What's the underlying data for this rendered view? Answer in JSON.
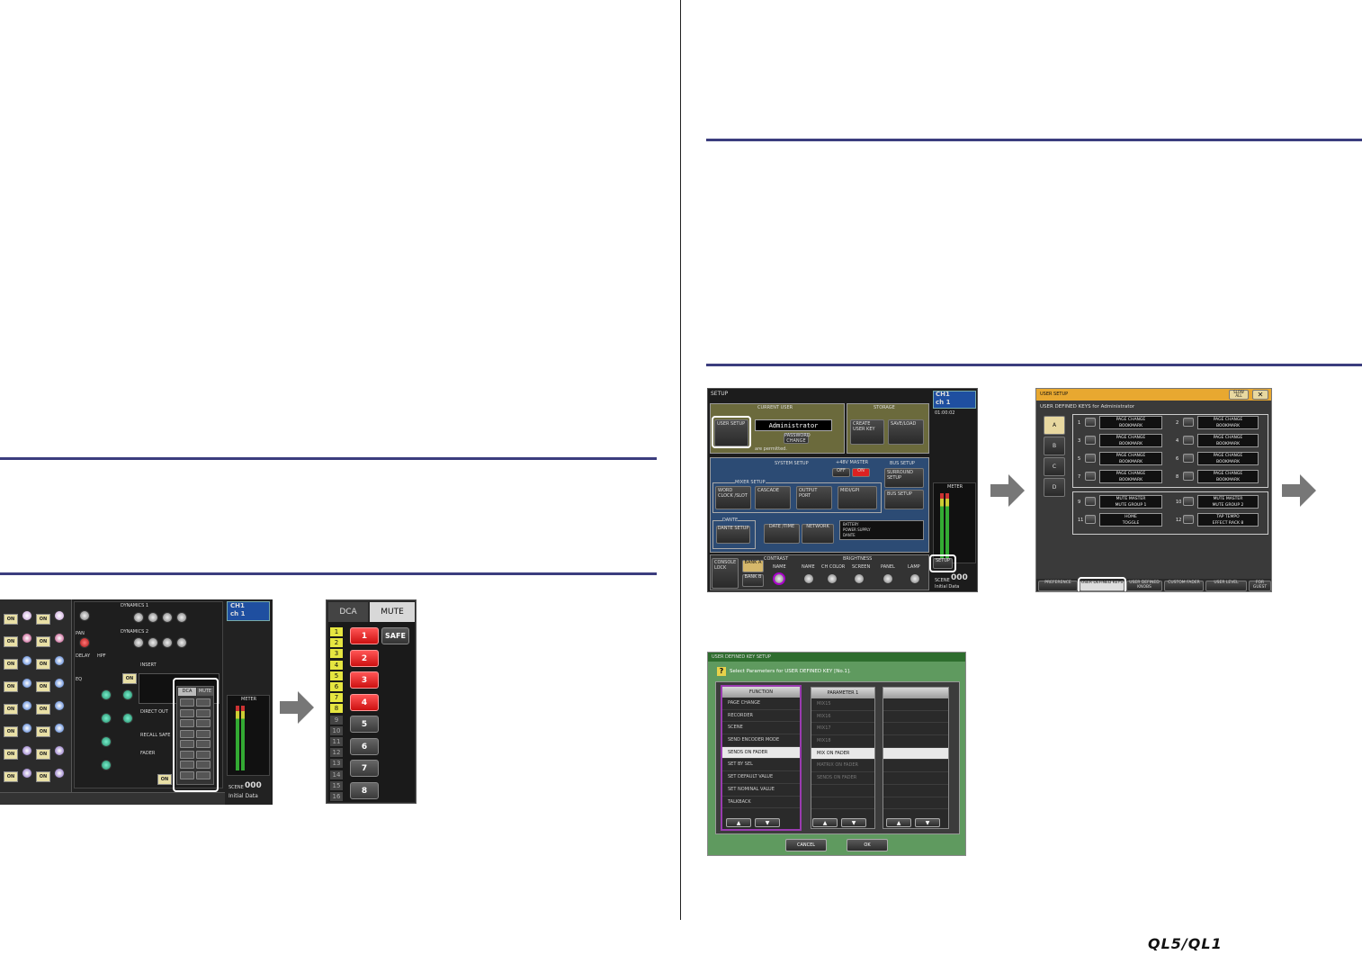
{
  "brand": "QL5/QL1",
  "mixer_shot": {
    "ch_label": "CH1",
    "ch_name": "ch 1",
    "tabs": [
      "DCA",
      "MUTE"
    ],
    "scene_label": "SCENE",
    "scene_number": "000",
    "scene_title": "Initial Data",
    "section_labels": [
      "EQ",
      "DYNAMICS 1",
      "DYNAMICS 2",
      "PAN",
      "DELAY",
      "HPF",
      "INSERT",
      "DIRECT OUT",
      "RECALL SAFE",
      "FADER",
      "METER"
    ]
  },
  "mute_panel": {
    "tabs": [
      "DCA",
      "MUTE"
    ],
    "safe_label": "SAFE",
    "group_numbers": [
      "1",
      "2",
      "3",
      "4",
      "5",
      "6",
      "7",
      "8",
      "9",
      "10",
      "11",
      "12",
      "13",
      "14",
      "15",
      "16"
    ],
    "buttons": [
      {
        "label": "1",
        "active": true
      },
      {
        "label": "2",
        "active": true
      },
      {
        "label": "3",
        "active": true
      },
      {
        "label": "4",
        "active": true
      },
      {
        "label": "5",
        "active": false
      },
      {
        "label": "6",
        "active": false
      },
      {
        "label": "7",
        "active": false
      },
      {
        "label": "8",
        "active": false
      }
    ]
  },
  "setup_shot": {
    "title": "SETUP",
    "current_user": "CURRENT USER",
    "user_name": "Administrator",
    "user_setup": "USER SETUP",
    "password_change": "PASSWORD CHANGE",
    "permitted_text": "are permitted.",
    "storage": "STORAGE",
    "create_user_key": "CREATE USER KEY",
    "save_load": "SAVE/LOAD",
    "system_setup": "SYSTEM SETUP",
    "phantom_master": "+48V MASTER",
    "off": "OFF",
    "on": "ON",
    "bus_setup": "BUS SETUP",
    "surround_setup": "SURROUND SETUP",
    "bus_setup_btn": "BUS SETUP",
    "mixer_setup": "MIXER SETUP",
    "word_clock": "WORD CLOCK /SLOT",
    "cascade": "CASCADE",
    "output_port": "OUTPUT PORT",
    "midi_gpi": "MIDI/GPI",
    "dante": "DANTE",
    "dante_setup": "DANTE SETUP",
    "date_time": "DATE /TIME",
    "network": "NETWORK",
    "battery": "BATTERY",
    "power_supply": "POWER SUPPLY",
    "console_lock": "CONSOLE LOCK",
    "contrast": "CONTRAST",
    "brightness": "BRIGHTNESS",
    "bank_a": "BANK A",
    "bank_b": "BANK B",
    "name": "NAME",
    "ch_color": "CH COLOR",
    "screen": "SCREEN",
    "panel": "PANEL",
    "lamp": "LAMP",
    "setup_btn": "SETUP",
    "ch_label": "CH1",
    "ch_name": "ch 1",
    "time": "01:00:02",
    "scene_label": "SCENE",
    "scene_number": "000",
    "scene_title": "Initial Data",
    "meter": "METER"
  },
  "user_setup_shot": {
    "title": "USER SETUP",
    "header": "USER DEFINED KEYS for Administrator",
    "banks": [
      "A",
      "B",
      "C",
      "D"
    ],
    "keys": [
      {
        "num": "1",
        "line1": "PAGE CHANGE",
        "line2": "BOOKMARK"
      },
      {
        "num": "2",
        "line1": "PAGE CHANGE",
        "line2": "BOOKMARK"
      },
      {
        "num": "3",
        "line1": "PAGE CHANGE",
        "line2": "BOOKMARK"
      },
      {
        "num": "4",
        "line1": "PAGE CHANGE",
        "line2": "BOOKMARK"
      },
      {
        "num": "5",
        "line1": "PAGE CHANGE",
        "line2": "BOOKMARK"
      },
      {
        "num": "6",
        "line1": "PAGE CHANGE",
        "line2": "BOOKMARK"
      },
      {
        "num": "7",
        "line1": "PAGE CHANGE",
        "line2": "BOOKMARK"
      },
      {
        "num": "8",
        "line1": "PAGE CHANGE",
        "line2": "BOOKMARK"
      },
      {
        "num": "9",
        "line1": "MUTE MASTER",
        "line2": "MUTE GROUP 1"
      },
      {
        "num": "10",
        "line1": "MUTE MASTER",
        "line2": "MUTE GROUP 2"
      },
      {
        "num": "11",
        "line1": "HOME",
        "line2": "TOGGLE"
      },
      {
        "num": "12",
        "line1": "TAP TEMPO",
        "line2": "EFFECT RACK 8"
      }
    ],
    "tabs": [
      "PREFERENCE",
      "USER DEFINED KEYS",
      "USER DEFINED KNOBS",
      "CUSTOM FADER",
      "USER LEVEL",
      "FOR GUEST"
    ],
    "slow_all": "SLOW ALL"
  },
  "key_dialog": {
    "title": "USER DEFINED KEY SETUP",
    "prompt": "Select Parameters for USER DEFINED KEY [No.1].",
    "function_header": "FUNCTION",
    "parameter_header": "PARAMETER 1",
    "functions": [
      "PAGE CHANGE",
      "RECORDER",
      "SCENE",
      "SEND ENCODER MODE",
      "SENDS ON FADER",
      "SET BY SEL",
      "SET DEFAULT VALUE",
      "SET NOMINAL VALUE",
      "TALKBACK"
    ],
    "function_selected": 4,
    "parameters": [
      "MIX15",
      "MIX16",
      "MIX17",
      "MIX18",
      "MIX ON FADER",
      "MATRIX ON FADER",
      "SENDS ON FADER",
      "",
      ""
    ],
    "parameter_selected": 4,
    "cancel": "CANCEL",
    "ok": "OK"
  }
}
